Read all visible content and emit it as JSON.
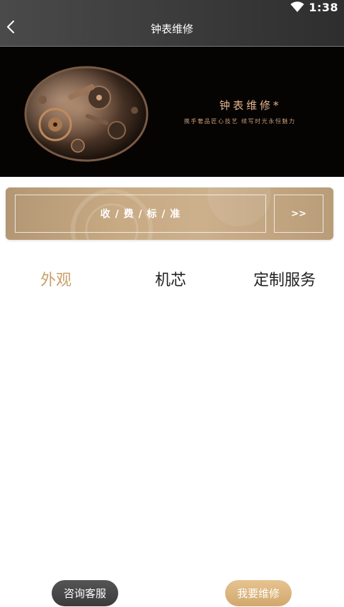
{
  "status_bar": {
    "time": "1:38"
  },
  "header": {
    "title": "钟表维修"
  },
  "banner": {
    "title": "钟表维修*",
    "subtitle": "携手奢品匠心技艺  续写时光永恒魅力"
  },
  "fee_panel": {
    "label": "收 / 费 / 标 / 准",
    "more_label": ">>"
  },
  "tabs": [
    {
      "label": "外观",
      "active": true
    },
    {
      "label": "机芯",
      "active": false
    },
    {
      "label": "定制服务",
      "active": false
    }
  ],
  "footer": {
    "consult_label": "咨询客服",
    "repair_label": "我要维修"
  },
  "colors": {
    "accent": "#c8a06a",
    "header_bg": "#3c3c3c",
    "repair_button": "#dcb57d",
    "consult_button": "#474747"
  }
}
